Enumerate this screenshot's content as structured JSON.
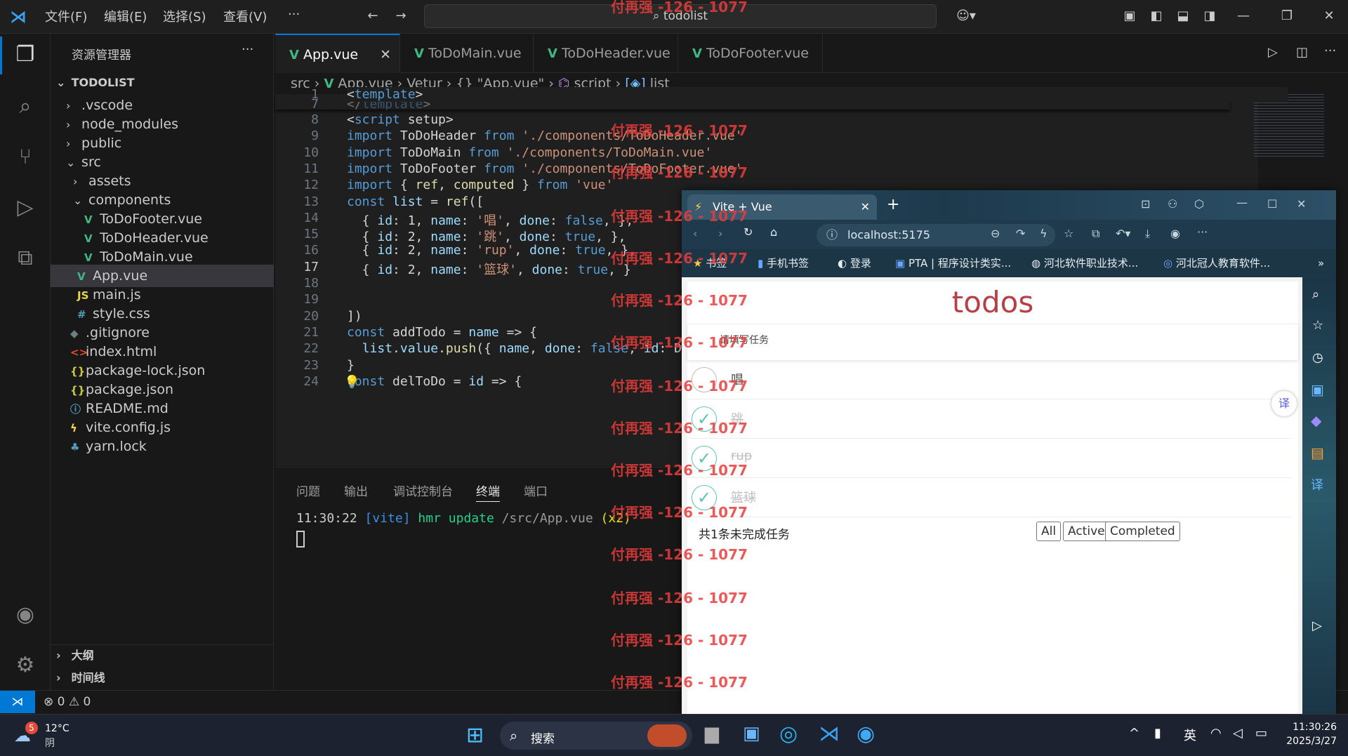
{
  "titlebar": {
    "menus": [
      "文件(F)",
      "编辑(E)",
      "选择(S)",
      "查看(V)",
      "···"
    ],
    "search": "todolist"
  },
  "sidebar": {
    "title": "资源管理器",
    "more": "···",
    "root": "TODOLIST",
    "items": [
      {
        "label": ".vscode",
        "kind": "folder"
      },
      {
        "label": "node_modules",
        "kind": "folder"
      },
      {
        "label": "public",
        "kind": "folder"
      },
      {
        "label": "src",
        "kind": "folder-open"
      },
      {
        "label": "assets",
        "kind": "folder"
      },
      {
        "label": "components",
        "kind": "folder-open"
      },
      {
        "label": "ToDoFooter.vue",
        "kind": "vue"
      },
      {
        "label": "ToDoHeader.vue",
        "kind": "vue"
      },
      {
        "label": "ToDoMain.vue",
        "kind": "vue"
      },
      {
        "label": "App.vue",
        "kind": "vue",
        "selected": true
      },
      {
        "label": "main.js",
        "kind": "js"
      },
      {
        "label": "style.css",
        "kind": "css"
      },
      {
        "label": ".gitignore",
        "kind": "git"
      },
      {
        "label": "index.html",
        "kind": "html"
      },
      {
        "label": "package-lock.json",
        "kind": "json"
      },
      {
        "label": "package.json",
        "kind": "json"
      },
      {
        "label": "README.md",
        "kind": "info"
      },
      {
        "label": "vite.config.js",
        "kind": "vite"
      },
      {
        "label": "yarn.lock",
        "kind": "yarn"
      }
    ],
    "outline": "大纲",
    "timeline": "时间线"
  },
  "tabs": [
    "App.vue",
    "ToDoMain.vue",
    "ToDoHeader.vue",
    "ToDoFooter.vue"
  ],
  "breadcrumb": [
    "src",
    "App.vue",
    "Vetur",
    "{} \"App.vue\"",
    "script",
    "list"
  ],
  "code": {
    "lines": [
      {
        "n": "1",
        "text": "<template>"
      },
      {
        "n": "7",
        "text": "</template>"
      },
      {
        "n": "8",
        "text": "<script setup>"
      },
      {
        "n": "9",
        "text": "import ToDoHeader from './components/ToDoHeader.vue'"
      },
      {
        "n": "10",
        "text": "import ToDoMain from './components/ToDoMain.vue'"
      },
      {
        "n": "11",
        "text": "import ToDoFooter from './components/ToDoFooter.vue'"
      },
      {
        "n": "12",
        "text": "import { ref, computed } from 'vue'"
      },
      {
        "n": "13",
        "text": "const list = ref(["
      },
      {
        "n": "14",
        "text": "  { id: 1, name: '唱', done: false, },"
      },
      {
        "n": "15",
        "text": "  { id: 2, name: '跳', done: true, },"
      },
      {
        "n": "16",
        "text": "  { id: 2, name: 'rup', done: true, },"
      },
      {
        "n": "17",
        "text": "  { id: 2, name: '篮球', done: true, }"
      },
      {
        "n": "18",
        "text": ""
      },
      {
        "n": "19",
        "text": ""
      },
      {
        "n": "20",
        "text": "])"
      },
      {
        "n": "21",
        "text": "const addTodo = name => {"
      },
      {
        "n": "22",
        "text": "  list.value.push({ name, done: false, id: Date.now() })"
      },
      {
        "n": "23",
        "text": "}"
      },
      {
        "n": "24",
        "text": "const delToDo = id => {"
      }
    ]
  },
  "panel": {
    "tabs": [
      "问题",
      "输出",
      "调试控制台",
      "终端",
      "端口"
    ],
    "active_tab": "终端",
    "terminal": {
      "time": "11:30:22",
      "tag": "[vite]",
      "msg": "hmr update",
      "path": "/src/App.vue",
      "count": "(x2)"
    }
  },
  "status": {
    "errors": "0",
    "warnings": "0"
  },
  "browser": {
    "tab_title": "Vite + Vue",
    "url": "localhost:5175",
    "bookmarks": [
      "书签",
      "手机书签",
      "登录",
      "PTA | 程序设计类实...",
      "河北软件职业技术...",
      "河北冠人教育软件..."
    ],
    "app": {
      "title": "todos",
      "placeholder": "请填写任务",
      "items": [
        {
          "name": "唱",
          "done": false
        },
        {
          "name": "跳",
          "done": true
        },
        {
          "name": "rup",
          "done": true
        },
        {
          "name": "篮球",
          "done": true
        }
      ],
      "footer_count": "共1条未完成任务",
      "filters": [
        "All",
        "Active",
        "Completed"
      ]
    }
  },
  "taskbar": {
    "weather_temp": "12°C",
    "weather_desc": "阴",
    "weather_badge": "5",
    "search": "搜索",
    "ime": "英",
    "time": "11:30:26",
    "date": "2025/3/27"
  },
  "watermark": "付再强 -126 - 1077"
}
